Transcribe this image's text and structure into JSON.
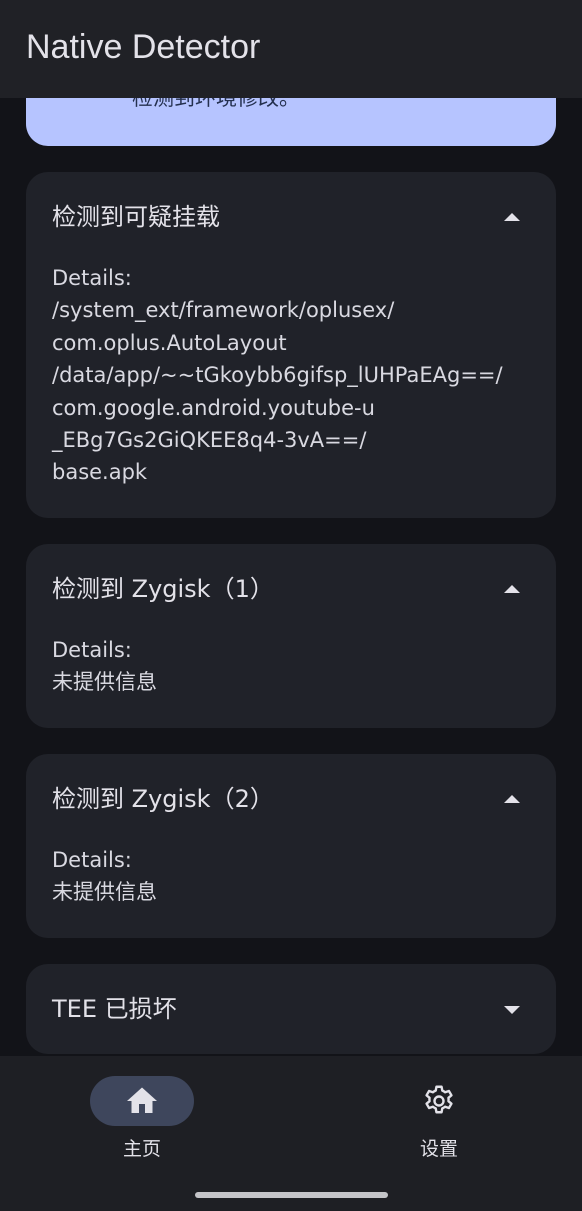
{
  "app_bar": {
    "title": "Native Detector"
  },
  "banner": {
    "text": "检测到环境修改。"
  },
  "cards": [
    {
      "title": "检测到可疑挂载",
      "expanded": true,
      "details_label": "Details:",
      "details_lines": [
        "/system_ext/framework/oplusex/",
        "com.oplus.AutoLayout",
        "/data/app/~~tGkoybb6gifsp_lUHPaEAg==/",
        "com.google.android.youtube-u",
        "_EBg7Gs2GiQKEE8q4-3vA==/",
        "base.apk"
      ]
    },
    {
      "title": "检测到 Zygisk（1）",
      "expanded": true,
      "details_label": "Details:",
      "details_lines": [
        "未提供信息"
      ]
    },
    {
      "title": "检测到 Zygisk（2）",
      "expanded": true,
      "details_label": "Details:",
      "details_lines": [
        "未提供信息"
      ]
    },
    {
      "title": "TEE 已损坏",
      "expanded": false
    }
  ],
  "bottom_nav": {
    "items": [
      {
        "label": "主页",
        "icon": "home-icon",
        "active": true
      },
      {
        "label": "设置",
        "icon": "gear-icon",
        "active": false
      }
    ]
  },
  "colors": {
    "background": "#121318",
    "surface": "#202229",
    "banner": "#b6c4ff",
    "active_pill": "#3e465c"
  }
}
